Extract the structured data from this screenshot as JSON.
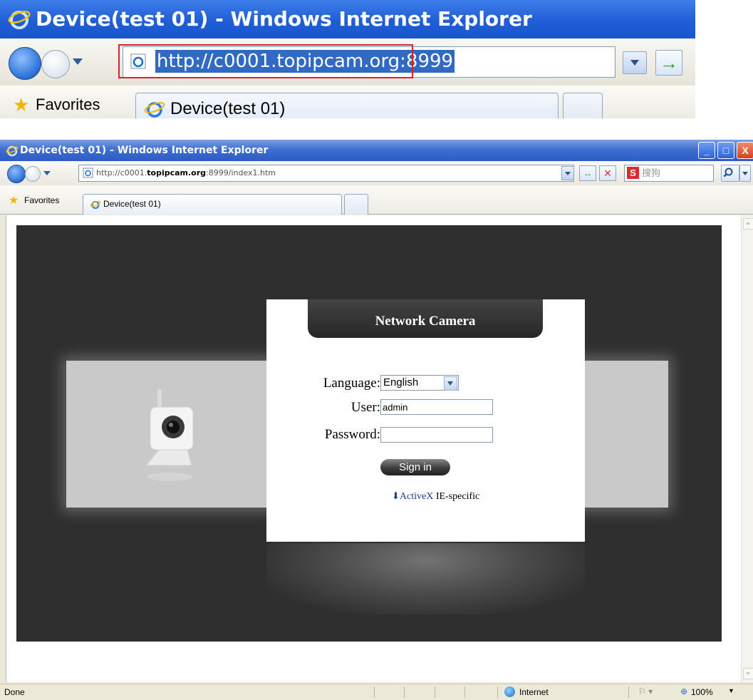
{
  "zoom_crop": {
    "window_title": "Device(test 01) - Windows Internet Explorer",
    "address_url": "http://c0001.topipcam.org:8999",
    "favorites_label": "Favorites",
    "tab_title": "Device(test 01)"
  },
  "window": {
    "title": "Device(test 01) - Windows Internet Explorer",
    "minimize_label": "_",
    "maximize_label": "□",
    "close_label": "X"
  },
  "address_bar": {
    "url_prefix": "http://c0001.",
    "url_domain": "topipcam.org",
    "url_suffix": ":8999/index1.htm",
    "search_placeholder": "搜狗",
    "search_logo": "S",
    "refresh_glyph": "↔",
    "stop_glyph": "✕"
  },
  "favorites_bar": {
    "favorites_label": "Favorites",
    "tab_title": "Device(test 01)"
  },
  "login": {
    "header": "Network Camera",
    "language_label": "Language:",
    "language_value": "English",
    "user_label": "User:",
    "user_value": "admin",
    "password_label": "Password:",
    "password_value": "",
    "signin_label": "Sign in",
    "activex_link": "ActiveX",
    "activex_suffix": "IE-specific"
  },
  "status_bar": {
    "status": "Done",
    "zone": "Internet",
    "zoom": "100%"
  },
  "colors": {
    "titlebar_blue": "#2c5bc4",
    "highlight_red": "#d8232a",
    "stage_dark": "#2f2f2f",
    "link_blue": "#1f3f8a"
  }
}
